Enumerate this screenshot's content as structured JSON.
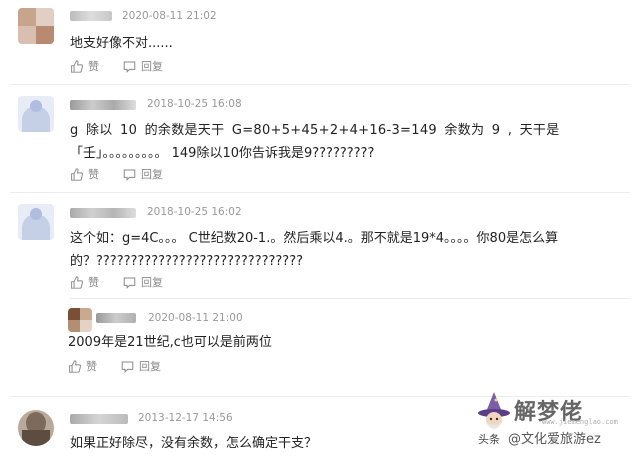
{
  "comments": [
    {
      "date": "2020-08-11 21:02",
      "text_lines": [
        "地支好像不对......"
      ],
      "like_label": "赞",
      "reply_label": "回复"
    },
    {
      "date": "2018-10-25 16:08",
      "text_lines": [
        "g 除以 10 的余数是天干 G=80+5+45+2+4+16-3=149 余数为 9 , 天干是",
        "「壬」。。。。。。。。。 149除以10你告诉我是9?????????"
      ],
      "like_label": "赞",
      "reply_label": "回复"
    },
    {
      "date": "2018-10-25 16:02",
      "text_lines": [
        "这个如：g=4C。。。 C世纪数20-1.。然后乘以4.。那不就是19*4。。。。你80是怎么算",
        "的？??????????????????????????????"
      ],
      "like_label": "赞",
      "reply_label": "回复"
    },
    {
      "date": "2020-08-11 21:00",
      "text_lines": [
        "2009年是21世纪,c也可以是前两位"
      ],
      "like_label": "赞",
      "reply_label": "回复"
    },
    {
      "date": "2013-12-17 14:56",
      "text_lines": [
        "如果正好除尽，没有余数，怎么确定干支？"
      ]
    }
  ],
  "watermark": {
    "title": "解梦佬",
    "url": "www.jiemenglao.com",
    "handle": "@文化爱旅游ez"
  },
  "colors": {
    "meta": "#999999",
    "text": "#222222",
    "action": "#888888",
    "divider": "#ececec"
  }
}
